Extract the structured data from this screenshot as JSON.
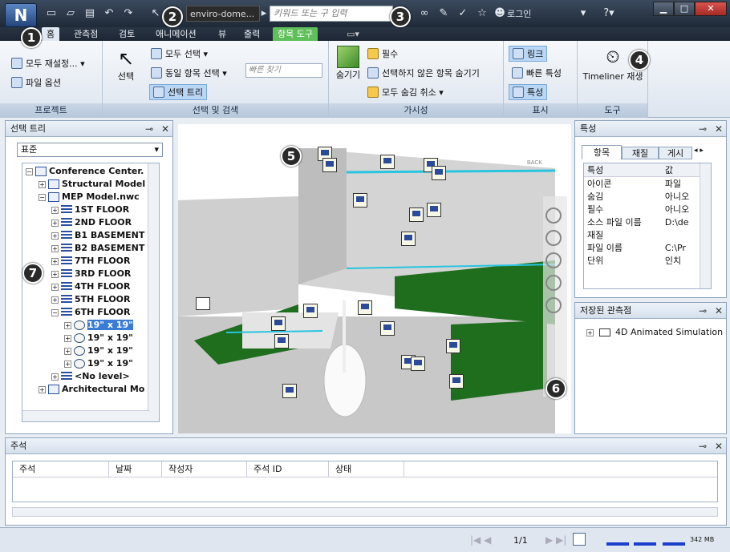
{
  "app": {
    "logo": "N",
    "document_name": "enviro-dome...",
    "search_placeholder": "키워드 또는 구 입력",
    "login": "로그인"
  },
  "tabs": [
    {
      "label": "홈",
      "state": "active"
    },
    {
      "label": "관측점"
    },
    {
      "label": "검토"
    },
    {
      "label": "애니메이션"
    },
    {
      "label": "뷰"
    },
    {
      "label": "출력"
    },
    {
      "label": "항목 도구",
      "state": "contextual"
    }
  ],
  "ribbon": {
    "project": {
      "title": "프로젝트",
      "refresh_all": "모두 재설정...",
      "file_options": "파일 옵션"
    },
    "select": {
      "title": "선택 및 검색",
      "select": "선택",
      "select_all": "모두 선택",
      "select_same": "동일 항목 선택",
      "selection_tree": "선택 트리",
      "quick_find_placeholder": "빠른 찾기"
    },
    "visibility": {
      "title": "가시성",
      "hide": "숨기기",
      "require": "필수",
      "hide_unselected": "선택하지 않은 항목 숨기기",
      "unhide_all": "모두 숨김 취소"
    },
    "display": {
      "title": "표시",
      "links": "링크",
      "quick_properties": "빠른 특성",
      "properties": "특성"
    },
    "tools": {
      "title": "도구",
      "timeliner": "Timeliner 재생"
    }
  },
  "selection_tree": {
    "title": "선택 트리",
    "mode": "표준",
    "items": [
      {
        "label": "Conference Center.",
        "depth": 0,
        "expander": "−",
        "icon": "file"
      },
      {
        "label": "Structural Model",
        "depth": 1,
        "expander": "+",
        "icon": "file"
      },
      {
        "label": "MEP Model.nwc",
        "depth": 1,
        "expander": "−",
        "icon": "file"
      },
      {
        "label": "1ST FLOOR",
        "depth": 2,
        "expander": "+",
        "icon": "layer"
      },
      {
        "label": "2ND FLOOR",
        "depth": 2,
        "expander": "+",
        "icon": "layer"
      },
      {
        "label": "B1 BASEMENT",
        "depth": 2,
        "expander": "+",
        "icon": "layer"
      },
      {
        "label": "B2  BASEMENT",
        "depth": 2,
        "expander": "+",
        "icon": "layer"
      },
      {
        "label": "7TH FLOOR",
        "depth": 2,
        "expander": "+",
        "icon": "layer"
      },
      {
        "label": "3RD FLOOR",
        "depth": 2,
        "expander": "+",
        "icon": "layer"
      },
      {
        "label": "4TH FLOOR",
        "depth": 2,
        "expander": "+",
        "icon": "layer"
      },
      {
        "label": "5TH FLOOR",
        "depth": 2,
        "expander": "+",
        "icon": "layer"
      },
      {
        "label": "6TH FLOOR",
        "depth": 2,
        "expander": "−",
        "icon": "layer"
      },
      {
        "label": "19\" x 19\"",
        "depth": 3,
        "expander": "+",
        "icon": "geo",
        "selected": true
      },
      {
        "label": "19\" x 19\"",
        "depth": 3,
        "expander": "+",
        "icon": "geo"
      },
      {
        "label": "19\" x 19\"",
        "depth": 3,
        "expander": "+",
        "icon": "geo"
      },
      {
        "label": "19\" x 19\"",
        "depth": 3,
        "expander": "+",
        "icon": "geo"
      },
      {
        "label": "<No level>",
        "depth": 2,
        "expander": "+",
        "icon": "layer"
      },
      {
        "label": "Architectural Mo",
        "depth": 1,
        "expander": "+",
        "icon": "file"
      }
    ]
  },
  "properties": {
    "title": "특성",
    "tabs": [
      "항목",
      "재질",
      "게시"
    ],
    "header": {
      "property": "특성",
      "value": "값"
    },
    "rows": [
      {
        "k": "아이콘",
        "v": "파일"
      },
      {
        "k": "숨김",
        "v": "아니오"
      },
      {
        "k": "필수",
        "v": "아니오"
      },
      {
        "k": "소스 파일 이름",
        "v": "D:\\de"
      },
      {
        "k": "재질",
        "v": ""
      },
      {
        "k": "파일 이름",
        "v": "C:\\Pr"
      },
      {
        "k": "단위",
        "v": "인치"
      }
    ]
  },
  "saved_views": {
    "title": "저장된 관측점",
    "items": [
      "4D Animated Simulation"
    ]
  },
  "comments": {
    "title": "주석",
    "columns": [
      "주석",
      "날짜",
      "작성자",
      "주석 ID",
      "상태"
    ]
  },
  "status": {
    "page": "1/1",
    "memory": "342 MB"
  },
  "viewcube": {
    "label": "BACK"
  },
  "callouts": [
    "1",
    "2",
    "3",
    "4",
    "5",
    "6",
    "7"
  ]
}
